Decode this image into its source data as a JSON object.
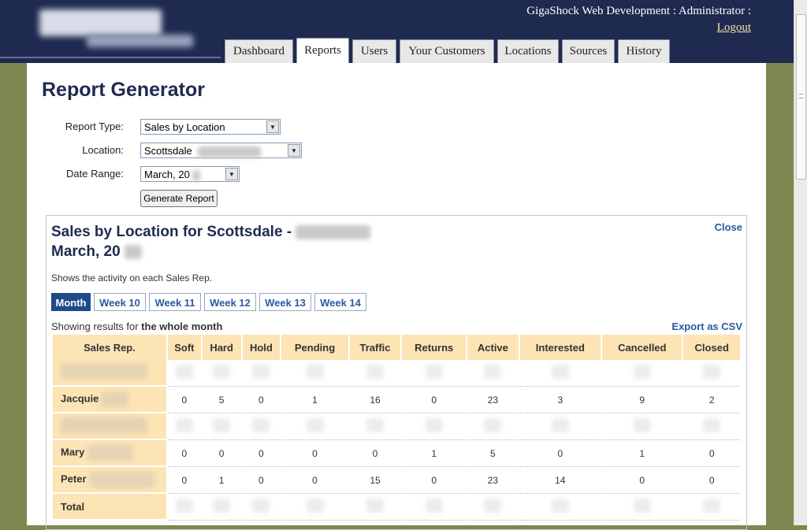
{
  "header": {
    "account_name": "GigaShock Web Development : Administrator :",
    "logout_label": "Logout"
  },
  "nav": {
    "tabs": [
      {
        "label": "Dashboard",
        "active": false
      },
      {
        "label": "Reports",
        "active": true
      },
      {
        "label": "Users",
        "active": false
      },
      {
        "label": "Your Customers",
        "active": false
      },
      {
        "label": "Locations",
        "active": false
      },
      {
        "label": "Sources",
        "active": false
      },
      {
        "label": "History",
        "active": false
      }
    ]
  },
  "page": {
    "title": "Report Generator"
  },
  "form": {
    "report_type_label": "Report Type:",
    "report_type_value": "Sales by Location",
    "location_label": "Location:",
    "location_value": "Scottsdale",
    "date_range_label": "Date Range:",
    "date_range_value": "March, 20",
    "generate_button": "Generate Report"
  },
  "report": {
    "title_line1": "Sales by Location for Scottsdale -",
    "title_line2": "March, 20",
    "close_label": "Close",
    "description": "Shows the activity on each Sales Rep.",
    "week_tabs": [
      {
        "label": "Month",
        "active": true
      },
      {
        "label": "Week 10",
        "active": false
      },
      {
        "label": "Week 11",
        "active": false
      },
      {
        "label": "Week 12",
        "active": false
      },
      {
        "label": "Week 13",
        "active": false
      },
      {
        "label": "Week 14",
        "active": false
      }
    ],
    "results_prefix": "Showing results for ",
    "results_scope": "the whole month",
    "export_label": "Export as CSV"
  },
  "table": {
    "columns": [
      "Sales Rep.",
      "Soft",
      "Hard",
      "Hold",
      "Pending",
      "Traffic",
      "Returns",
      "Active",
      "Interested",
      "Cancelled",
      "Closed"
    ],
    "rows": [
      {
        "name": "",
        "values": [
          "",
          "",
          "",
          "",
          "",
          "",
          "",
          "",
          "",
          ""
        ]
      },
      {
        "name": "Jacquie",
        "values": [
          "0",
          "5",
          "0",
          "1",
          "16",
          "0",
          "23",
          "3",
          "9",
          "2"
        ]
      },
      {
        "name": "",
        "values": [
          "",
          "",
          "",
          "",
          "",
          "",
          "",
          "",
          "",
          ""
        ]
      },
      {
        "name": "Mary",
        "values": [
          "0",
          "0",
          "0",
          "0",
          "0",
          "1",
          "5",
          "0",
          "1",
          "0"
        ]
      },
      {
        "name": "Peter",
        "values": [
          "0",
          "1",
          "0",
          "0",
          "15",
          "0",
          "23",
          "14",
          "0",
          "0"
        ]
      },
      {
        "name": "Total",
        "values": [
          "",
          "",
          "",
          "",
          "",
          "",
          "",
          "",
          "",
          ""
        ]
      }
    ]
  }
}
